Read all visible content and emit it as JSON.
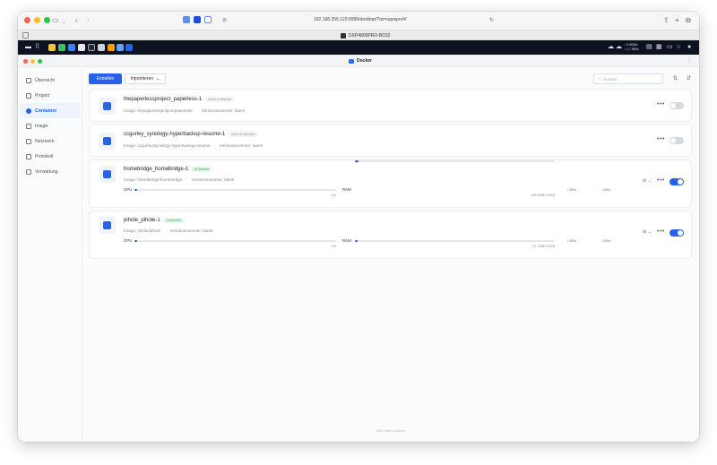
{
  "browser": {
    "url": "192.168.255.123:9999/desktop/?os=ugospro#/",
    "tab_title": "DXP4800PRO-BD32"
  },
  "taskbar": {
    "net_up": "↑ 0.0KB/s",
    "net_down": "↓ 1.7 KB/s"
  },
  "app": {
    "title": "Docker"
  },
  "sidebar": {
    "items": [
      {
        "label": "Übersicht"
      },
      {
        "label": "Projekt"
      },
      {
        "label": "Container"
      },
      {
        "label": "Image"
      },
      {
        "label": "Netzwerk"
      },
      {
        "label": "Protokoll"
      },
      {
        "label": "Verwaltung"
      }
    ]
  },
  "toolbar": {
    "create_label": "Erstellen",
    "import_label": "Importieren",
    "search_placeholder": "Suchen"
  },
  "containers": [
    {
      "name": "thepaperlessproject_paperless-1",
      "status": "Nicht in Betrieb",
      "image": "Image: thepaperlessproject/paperless",
      "version": "Versionsnummer: latest",
      "running": false
    },
    {
      "name": "ccgurley_synology-hyperbackup-resume-1",
      "status": "Nicht in Betrieb",
      "image": "Image: ccgurley/synology-hyperbackup-resume",
      "version": "Versionsnummer: latest",
      "running": false
    },
    {
      "name": "homebridge_homebridge-1",
      "status": "In Betrieb",
      "image": "Image: homebridge/homebridge",
      "version": "Versionsnummer: latest",
      "running": true,
      "cpu_label": "CPU",
      "cpu_value": "0%",
      "cpu_fraction": 0.005,
      "ram_label": "RAM",
      "ram_value": "149.5MB/7.5GB",
      "ram_fraction": 0.02,
      "net_up": "0B/s",
      "net_down": "0B/s"
    },
    {
      "name": "pihole_pihole-1",
      "status": "In Betrieb",
      "image": "Image: pihole/pihole",
      "version": "Versionsnummer: latest",
      "running": true,
      "cpu_label": "CPU",
      "cpu_value": "0%",
      "cpu_fraction": 0.005,
      "ram_label": "RAM",
      "ram_value": "37.7MB/7.5GB",
      "ram_fraction": 0.005,
      "net_up": "0B/s",
      "net_down": "0B/s"
    }
  ],
  "footer": {
    "text": "Alle Daten geladen"
  },
  "colors": {
    "accent": "#2563eb",
    "running": "#2f9e54"
  }
}
